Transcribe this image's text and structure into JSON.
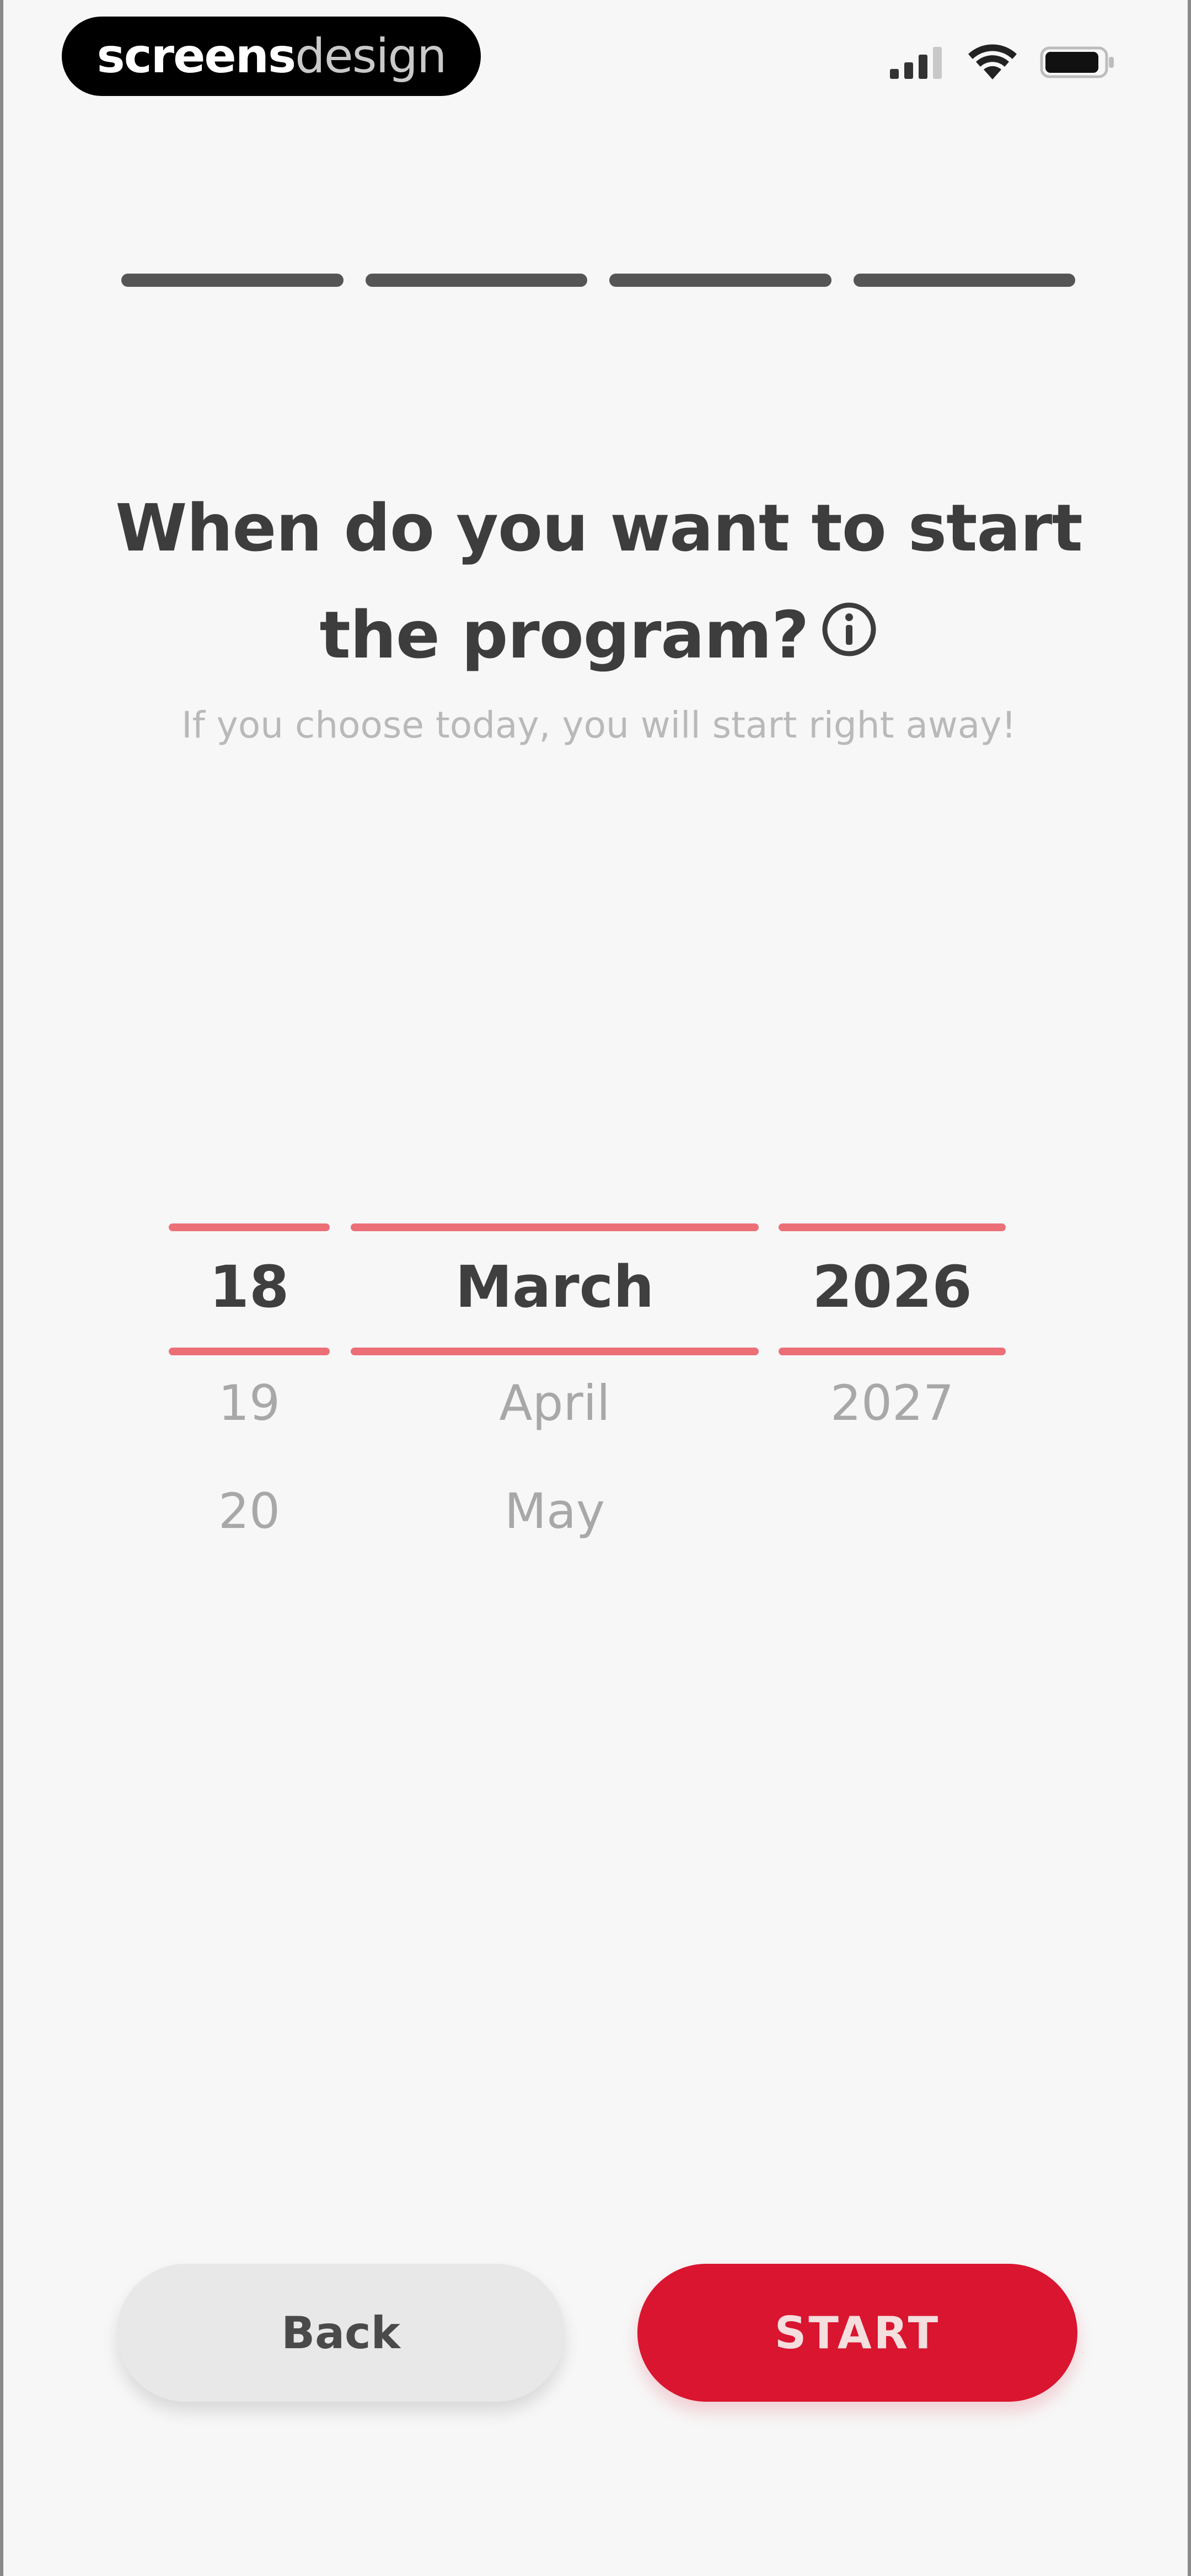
{
  "status_bar": {
    "logo_bold": "screens",
    "logo_light": "design",
    "signal_icon": "cellular-signal-icon",
    "wifi_icon": "wifi-icon",
    "battery_icon": "battery-icon"
  },
  "progress": {
    "total_steps": 4,
    "completed_steps": 4,
    "segment_color": "#555555"
  },
  "question": {
    "title": "When do you want to start the program?",
    "info_icon": "info-icon",
    "subtitle": "If you choose today, you will start right away!"
  },
  "date_picker": {
    "accent_color": "#ec6f78",
    "day": {
      "selected": "18",
      "next": [
        "19",
        "20"
      ]
    },
    "month": {
      "selected": "March",
      "next": [
        "April",
        "May"
      ]
    },
    "year": {
      "selected": "2026",
      "next": [
        "2027"
      ]
    }
  },
  "actions": {
    "back_label": "Back",
    "start_label": "START",
    "start_color": "#d91530"
  }
}
